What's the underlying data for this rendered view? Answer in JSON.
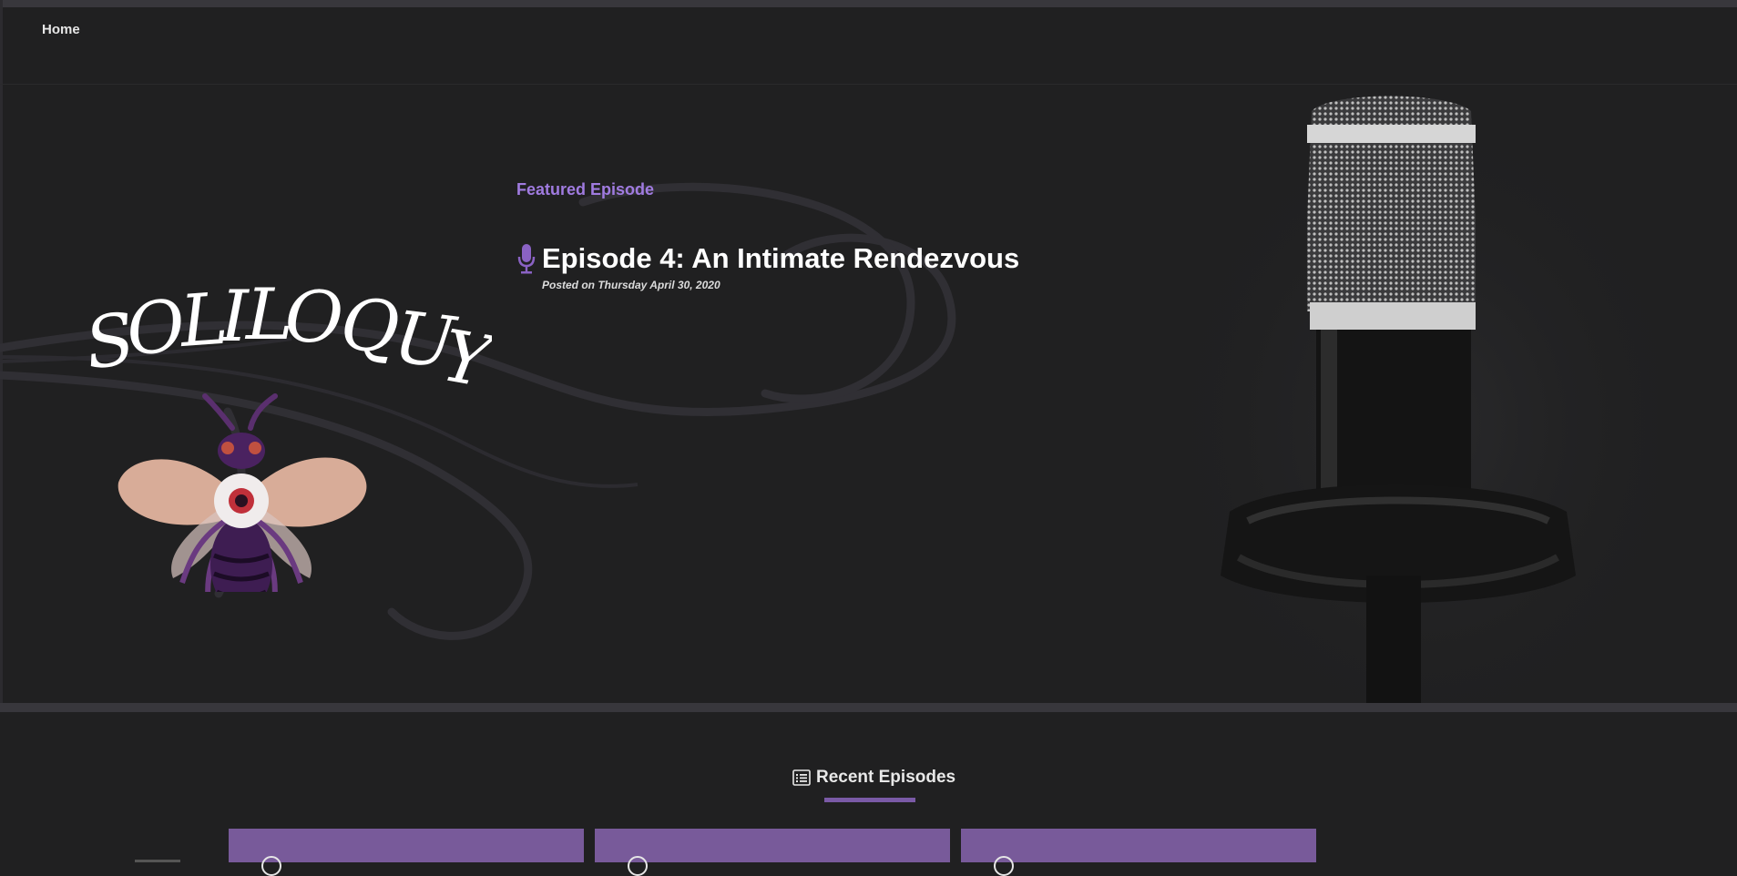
{
  "nav": {
    "home_label": "Home"
  },
  "logo": {
    "title": "SOLILOQUY"
  },
  "featured": {
    "section_label": "Featured Episode",
    "episode_title": "Episode 4: An Intimate Rendezvous",
    "posted_date": "Posted on Thursday April 30, 2020",
    "icon": "microphone-icon"
  },
  "recent": {
    "heading": "Recent Episodes",
    "icon": "list-icon",
    "cards": [
      {},
      {},
      {}
    ]
  },
  "colors": {
    "accent_purple": "#a07be0",
    "card_purple": "#785a9a",
    "background": "#202021"
  }
}
